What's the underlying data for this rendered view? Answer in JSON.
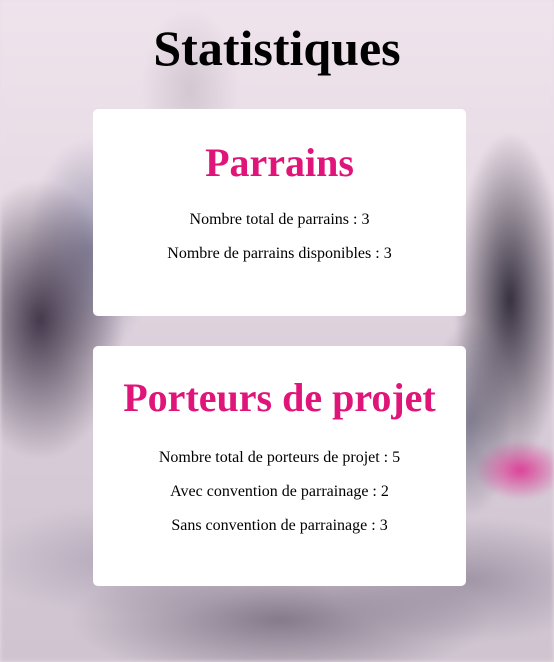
{
  "page": {
    "title": "Statistiques"
  },
  "parrains": {
    "heading": "Parrains",
    "stats": [
      {
        "text": "Nombre total de parrains : 3"
      },
      {
        "text": "Nombre de parrains disponibles : 3"
      }
    ]
  },
  "porteurs": {
    "heading": "Porteurs de projet",
    "stats": [
      {
        "text": "Nombre total de porteurs de projet : 5"
      },
      {
        "text": "Avec convention de parrainage : 2"
      },
      {
        "text": "Sans convention de parrainage : 3"
      }
    ]
  },
  "colors": {
    "accent": "#e0157a",
    "card_background": "#ffffff",
    "title": "#000000"
  }
}
